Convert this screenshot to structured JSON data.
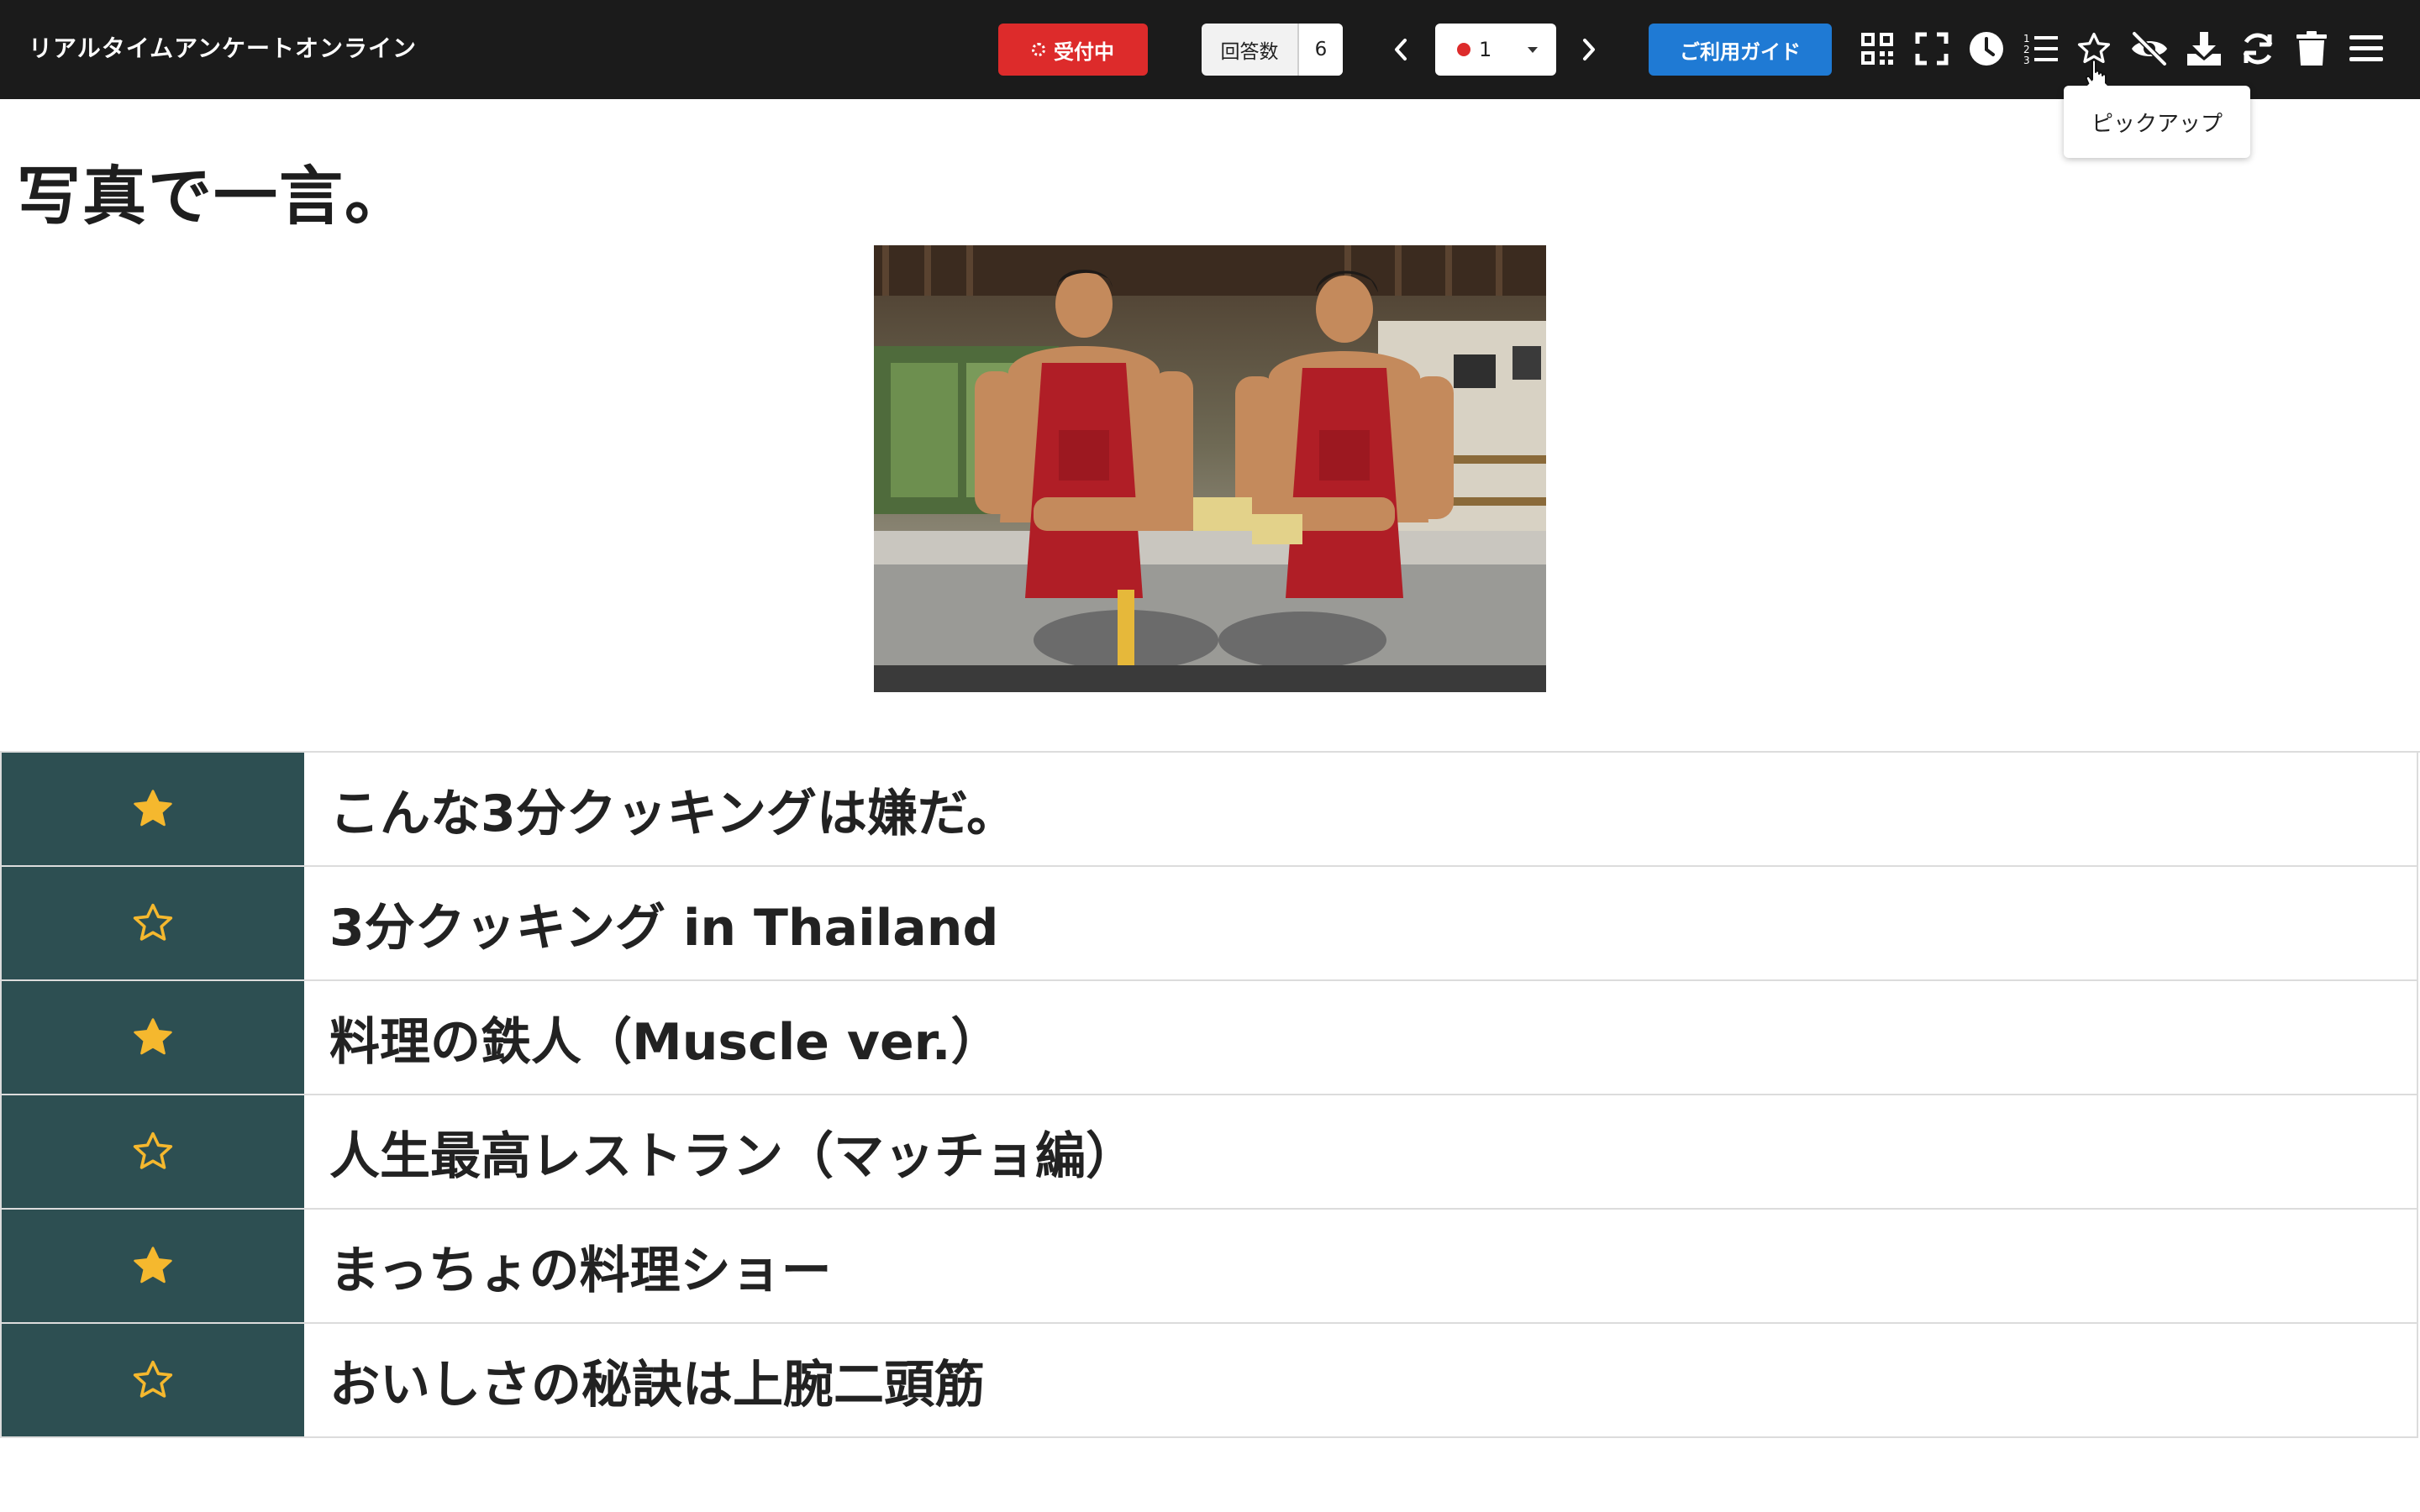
{
  "header": {
    "app_title": "リアルタイムアンケートオンライン",
    "status_label": "受付中",
    "answer_count_label": "回答数",
    "answer_count": "6",
    "question_select": {
      "selected": "1",
      "dot_color": "#dd2b2b"
    },
    "guide_label": "ご利用ガイド",
    "tools": [
      {
        "icon": "qr-code-icon"
      },
      {
        "icon": "fullscreen-icon"
      },
      {
        "icon": "clock-icon"
      },
      {
        "icon": "numbered-list-icon"
      },
      {
        "icon": "star-outline-icon"
      },
      {
        "icon": "eye-slash-icon"
      },
      {
        "icon": "download-icon"
      },
      {
        "icon": "refresh-icon"
      },
      {
        "icon": "trash-icon"
      },
      {
        "icon": "menu-icon"
      }
    ],
    "tooltip": "ピックアップ"
  },
  "question": {
    "title": "写真で一言。",
    "image": "photo of two muscular men in red aprons at a cooking station"
  },
  "answers": [
    {
      "text": "こんな3分クッキングは嫌だ。",
      "picked": true
    },
    {
      "text": "3分クッキング in Thailand",
      "picked": false
    },
    {
      "text": "料理の鉄人（Muscle ver.）",
      "picked": true
    },
    {
      "text": "人生最高レストラン（マッチョ編）",
      "picked": false
    },
    {
      "text": "まっちょの料理ショー",
      "picked": true
    },
    {
      "text": "おいしさの秘訣は上腕二頭筋",
      "picked": false
    }
  ],
  "colors": {
    "header_bg": "#1b1b1b",
    "status_red": "#dd2b2b",
    "guide_blue": "#1f7ad4",
    "star_cell_bg": "#2d4f52",
    "star_gold": "#f5b82e"
  }
}
